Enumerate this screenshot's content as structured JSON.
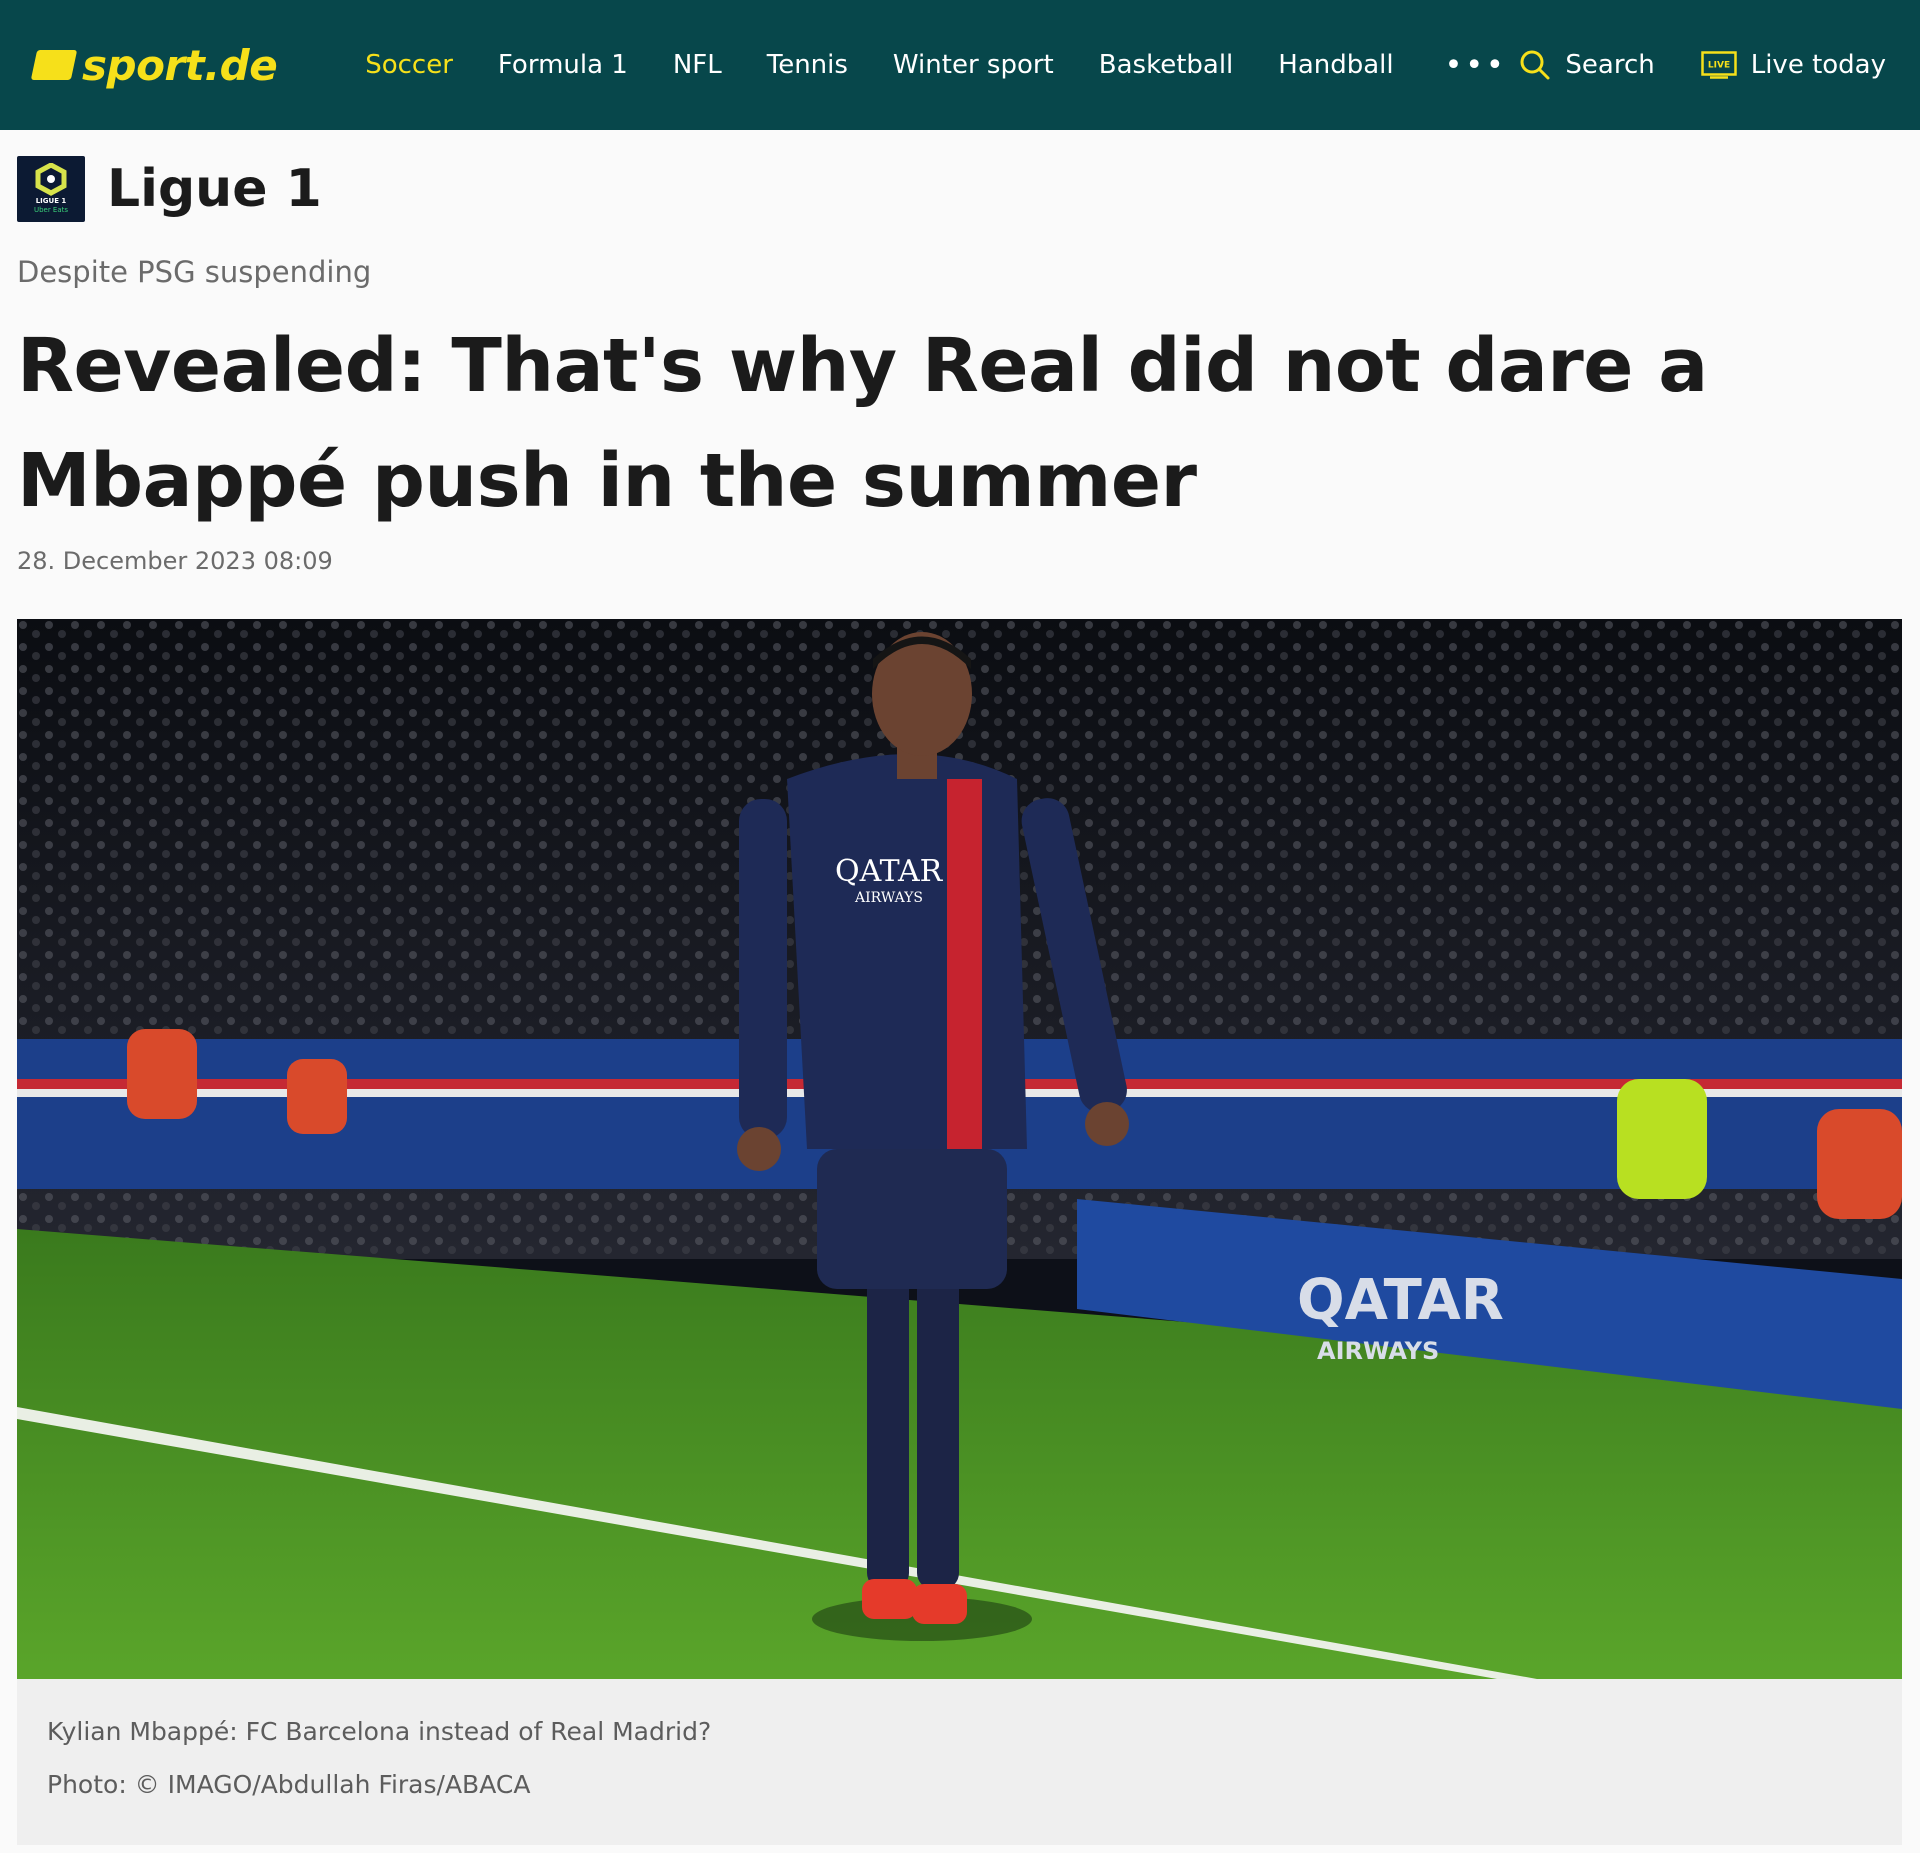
{
  "site": {
    "logo_text": "sport.de"
  },
  "nav": {
    "items": [
      {
        "label": "Soccer",
        "active": true
      },
      {
        "label": "Formula 1"
      },
      {
        "label": "NFL"
      },
      {
        "label": "Tennis"
      },
      {
        "label": "Winter sport"
      },
      {
        "label": "Basketball"
      },
      {
        "label": "Handball"
      }
    ],
    "more_label": "•••",
    "search_label": "Search",
    "live_badge": "LIVE",
    "live_label": "Live today"
  },
  "league": {
    "name": "Ligue 1",
    "logo_line1": "LIGUE 1",
    "logo_line2": "Uber Eats"
  },
  "article": {
    "kicker": "Despite PSG suspending",
    "headline": "Revealed: That's why Real did not dare a Mbappé push in the summer",
    "date": "28. December 2023 08:09"
  },
  "photo": {
    "sponsor_shirt_1": "QATAR",
    "sponsor_shirt_2": "AIRWAYS",
    "board_1": "QATAR",
    "board_2": "AIRWAYS",
    "caption": "Kylian Mbappé: FC Barcelona instead of Real Madrid?",
    "credit": "Photo: © IMAGO/Abdullah Firas/ABACA"
  },
  "colors": {
    "header_bg": "#07474b",
    "accent": "#f6e01a"
  }
}
